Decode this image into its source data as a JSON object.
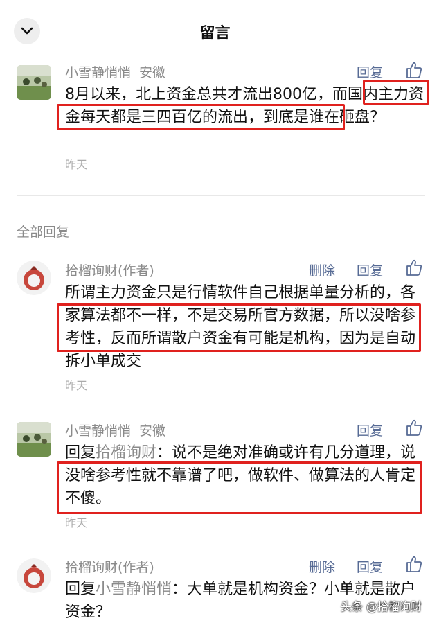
{
  "header": {
    "title": "留言"
  },
  "top_comment": {
    "author": "小雪静悄悄",
    "location": "安徽",
    "reply_label": "回复",
    "text": "8月以来，北上资金总共才流出800亿，而国内主力资金每天都是三四百亿的流出，到底是谁在砸盘？",
    "time": "昨天"
  },
  "section_label": "全部回复",
  "replies": [
    {
      "author": "拾榴询财(作者)",
      "delete_label": "删除",
      "reply_label": "回复",
      "text": "所谓主力资金只是行情软件自己根据单量分析的，各家算法都不一样，不是交易所官方数据，所以没啥参考性，反而所谓散户资金有可能是机构，因为是自动拆小单成交",
      "time": "昨天"
    },
    {
      "author": "小雪静悄悄",
      "location": "安徽",
      "reply_label": "回复",
      "prefix": "回复",
      "target": "拾榴询财",
      "text": "：说不是绝对准确或许有几分道理，说没啥参考性就不靠谱了吧，做软件、做算法的人肯定不傻。",
      "time": "昨天"
    },
    {
      "author": "拾榴询财(作者)",
      "delete_label": "删除",
      "reply_label": "回复",
      "prefix": "回复",
      "target": "小雪静悄悄",
      "text": "：大单就是机构资金？小单就是散户资金？"
    }
  ],
  "watermark": "头条 @拾榴询财",
  "colors": {
    "link": "#576b95",
    "highlight_box": "#e0211e",
    "meta": "#8a8a8a"
  },
  "icons": [
    "chevron-down-icon",
    "thumbs-up-icon"
  ]
}
